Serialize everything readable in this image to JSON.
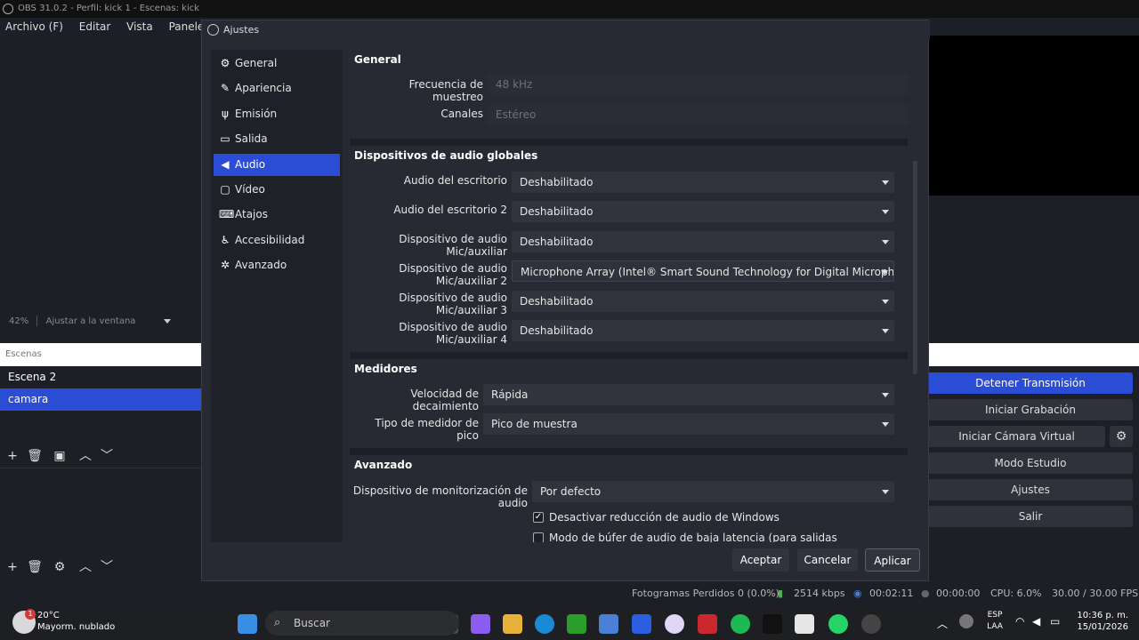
{
  "obs": {
    "title": "OBS 31.0.2 - Perfil: kick 1 - Escenas: kick",
    "menu": [
      "Archivo (F)",
      "Editar",
      "Vista",
      "Paneles (D)"
    ],
    "zoom": {
      "percent": "42%",
      "mode": "Ajustar a la ventana"
    },
    "scenes": {
      "header": "Escenas",
      "items": [
        "Escena 2",
        "camara"
      ],
      "selected": "camara"
    },
    "controls": {
      "stop_stream": "Detener Transmisión",
      "start_recording": "Iniciar Grabación",
      "start_virtual_cam": "Iniciar Cámara Virtual",
      "studio_mode": "Modo Estudio",
      "settings": "Ajustes",
      "exit": "Salir"
    },
    "status": {
      "dropped_frames": "Fotogramas Perdidos 0 (0.0%)",
      "bitrate": "2514 kbps",
      "stream_time": "00:02:11",
      "rec_time": "00:00:00",
      "cpu": "CPU: 6.0%",
      "fps": "30.00 / 30.00 FPS"
    }
  },
  "dialog": {
    "title": "Ajustes",
    "nav": [
      {
        "label": "General",
        "icon": "gear-icon"
      },
      {
        "label": "Apariencia",
        "icon": "appearance-icon"
      },
      {
        "label": "Emisión",
        "icon": "broadcast-icon"
      },
      {
        "label": "Salida",
        "icon": "output-icon"
      },
      {
        "label": "Audio",
        "icon": "speaker-icon"
      },
      {
        "label": "Vídeo",
        "icon": "video-icon"
      },
      {
        "label": "Atajos",
        "icon": "keyboard-icon"
      },
      {
        "label": "Accesibilidad",
        "icon": "accessibility-icon"
      },
      {
        "label": "Avanzado",
        "icon": "advanced-icon"
      }
    ],
    "selected_nav": "Audio",
    "general": {
      "title": "General",
      "sample_rate_label": "Frecuencia de muestreo",
      "sample_rate_value": "48 kHz",
      "channels_label": "Canales",
      "channels_value": "Estéreo"
    },
    "global_devices": {
      "title": "Dispositivos de audio globales",
      "rows": [
        {
          "label": "Audio del escritorio",
          "value": "Deshabilitado"
        },
        {
          "label": "Audio del escritorio 2",
          "value": "Deshabilitado"
        },
        {
          "label": "Dispositivo de audio Mic/auxiliar",
          "value": "Deshabilitado"
        },
        {
          "label": "Dispositivo de audio Mic/auxiliar 2",
          "value": "Microphone Array (Intel® Smart Sound Technology for Digital Microphones)"
        },
        {
          "label": "Dispositivo de audio Mic/auxiliar 3",
          "value": "Deshabilitado"
        },
        {
          "label": "Dispositivo de audio Mic/auxiliar 4",
          "value": "Deshabilitado"
        }
      ]
    },
    "meters": {
      "title": "Medidores",
      "decay_label": "Velocidad de decaimiento",
      "decay_value": "Rápida",
      "peak_label": "Tipo de medidor de pico",
      "peak_value": "Pico de muestra"
    },
    "advanced": {
      "title": "Avanzado",
      "monitor_label": "Dispositivo de monitorización de audio",
      "monitor_value": "Por defecto",
      "ducking_label": "Desactivar reducción de audio de Windows",
      "ducking_checked": true,
      "lowlatency_label": "Modo de búfer de audio de baja latencia (para salidas Decklink/NDI)",
      "lowlatency_checked": false
    },
    "buttons": {
      "ok": "Aceptar",
      "cancel": "Cancelar",
      "apply": "Aplicar"
    }
  },
  "taskbar": {
    "weather_temp": "20°C",
    "weather_desc": "Mayorm. nublado",
    "weather_badge": "1",
    "search_placeholder": "Buscar",
    "lang_1": "ESP",
    "lang_2": "LAA",
    "time": "10:36 p. m.",
    "date": "15/01/2026"
  }
}
